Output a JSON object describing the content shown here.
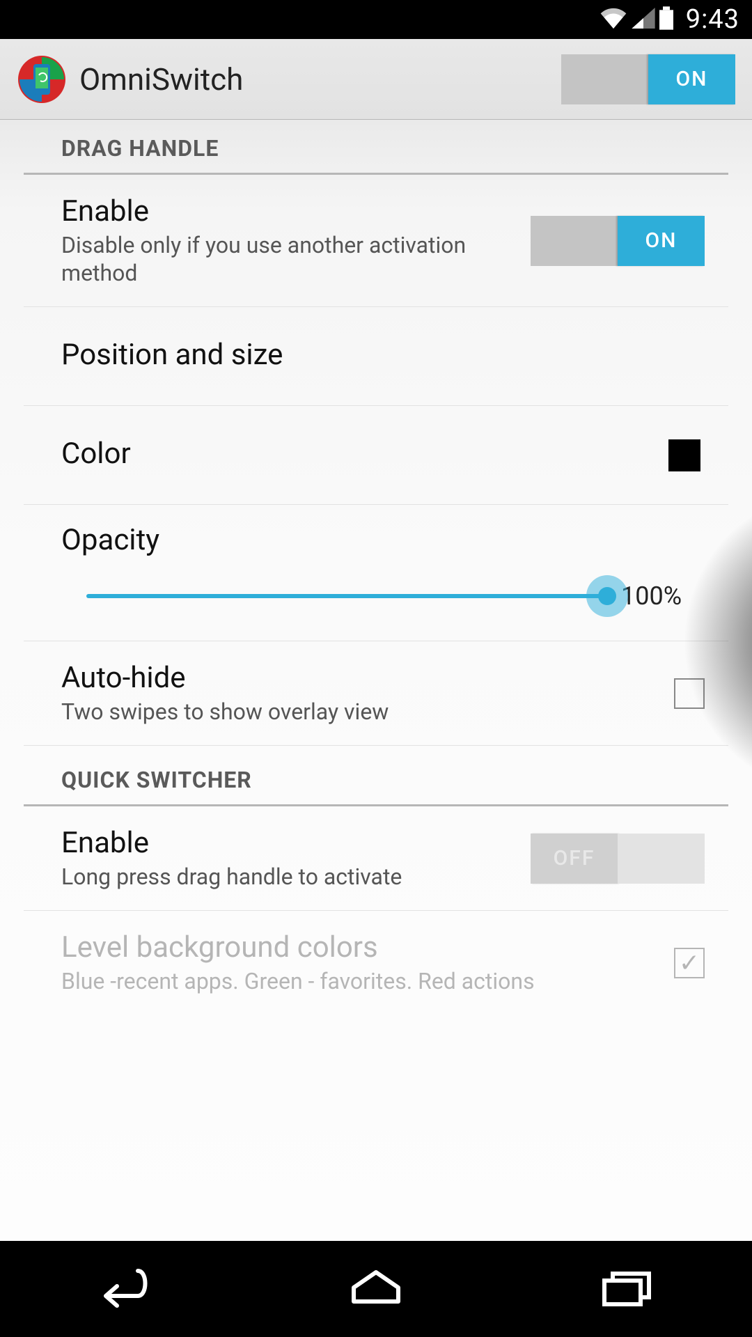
{
  "status": {
    "time": "9:43"
  },
  "header": {
    "title": "OmniSwitch",
    "toggle_label": "ON"
  },
  "sections": {
    "drag_handle": {
      "header": "DRAG HANDLE",
      "enable": {
        "title": "Enable",
        "sub": "Disable only if you use another activation method",
        "toggle_label": "ON"
      },
      "position": {
        "title": "Position and size"
      },
      "color": {
        "title": "Color",
        "value": "#000000"
      },
      "opacity": {
        "title": "Opacity",
        "value_text": "100%"
      },
      "autohide": {
        "title": "Auto-hide",
        "sub": "Two swipes to show overlay view"
      }
    },
    "quick_switcher": {
      "header": "QUICK SWITCHER",
      "enable": {
        "title": "Enable",
        "sub": "Long press drag handle to activate",
        "toggle_label": "OFF"
      },
      "level_bg": {
        "title": "Level background colors",
        "sub": "Blue -recent apps. Green - favorites. Red actions"
      }
    }
  }
}
